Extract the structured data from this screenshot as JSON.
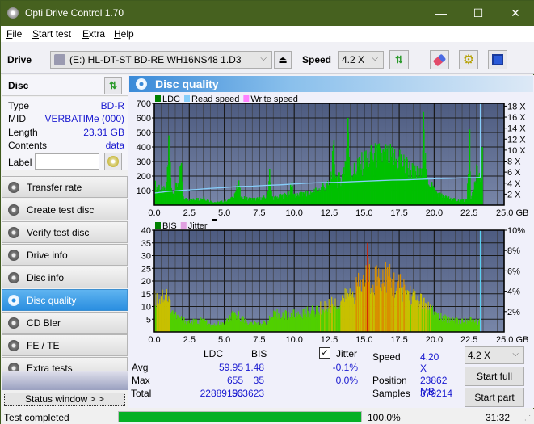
{
  "window": {
    "title": "Opti Drive Control 1.70",
    "minimize": "—",
    "maximize": "☐",
    "close": "✕"
  },
  "menu": [
    {
      "label": "File",
      "u": "F",
      "rest": "ile"
    },
    {
      "label": "Start test",
      "u": "S",
      "rest": "tart test"
    },
    {
      "label": "Extra",
      "u": "E",
      "rest": "xtra"
    },
    {
      "label": "Help",
      "u": "H",
      "rest": "elp"
    }
  ],
  "toolbar": {
    "drive_label": "Drive",
    "drive_value": "(E:)  HL-DT-ST BD-RE  WH16NS48 1.D3",
    "speed_label": "Speed",
    "speed_value": "4.2 X"
  },
  "disc": {
    "header": "Disc",
    "rows": [
      {
        "key": "Type",
        "value": "BD-R"
      },
      {
        "key": "MID",
        "value": "VERBATIMe (000)"
      },
      {
        "key": "Length",
        "value": "23.31 GB"
      },
      {
        "key": "Contents",
        "value": "data"
      }
    ],
    "label_key": "Label",
    "label_value": ""
  },
  "nav": [
    {
      "label": "Transfer rate",
      "active": false
    },
    {
      "label": "Create test disc",
      "active": false
    },
    {
      "label": "Verify test disc",
      "active": false
    },
    {
      "label": "Drive info",
      "active": false
    },
    {
      "label": "Disc info",
      "active": false
    },
    {
      "label": "Disc quality",
      "active": true
    },
    {
      "label": "CD Bler",
      "active": false
    },
    {
      "label": "FE / TE",
      "active": false
    },
    {
      "label": "Extra tests",
      "active": false
    }
  ],
  "status_window_label": "Status window > >",
  "panel_title": "Disc quality",
  "chart_data": [
    {
      "type": "area",
      "title": "LDC / Read speed",
      "legend": [
        {
          "name": "LDC",
          "color": "#008000"
        },
        {
          "name": "Read speed",
          "color": "#87cefa"
        },
        {
          "name": "Write speed",
          "color": "#ff80ff"
        }
      ],
      "legend_position": "top-left",
      "xlabel": "GB",
      "x_ticks": [
        "0.0",
        "2.5",
        "5.0",
        "7.5",
        "10.0",
        "12.5",
        "15.0",
        "17.5",
        "20.0",
        "22.5",
        "25.0 GB"
      ],
      "xlim": [
        0,
        25
      ],
      "y_ticks": [
        "100",
        "200",
        "300",
        "400",
        "500",
        "600",
        "700"
      ],
      "ylim": [
        0,
        700
      ],
      "y2_ticks": [
        "2 X",
        "4 X",
        "6 X",
        "8 X",
        "10 X",
        "12 X",
        "14 X",
        "16 X",
        "18 X"
      ],
      "y2lim": [
        0,
        18.5
      ],
      "grid": true,
      "ldc_profile": [
        [
          0,
          170
        ],
        [
          0.3,
          140
        ],
        [
          0.8,
          120
        ],
        [
          1.0,
          480
        ],
        [
          1.1,
          300
        ],
        [
          1.3,
          80
        ],
        [
          1.9,
          290
        ],
        [
          2.0,
          60
        ],
        [
          2.5,
          45
        ],
        [
          3.0,
          50
        ],
        [
          3.5,
          60
        ],
        [
          4.0,
          30
        ],
        [
          4.5,
          25
        ],
        [
          5.0,
          35
        ],
        [
          5.5,
          55
        ],
        [
          6.0,
          170
        ],
        [
          6.2,
          60
        ],
        [
          6.5,
          60
        ],
        [
          7.0,
          50
        ],
        [
          7.5,
          55
        ],
        [
          8.0,
          70
        ],
        [
          8.2,
          250
        ],
        [
          8.4,
          60
        ],
        [
          9.0,
          75
        ],
        [
          9.5,
          90
        ],
        [
          9.8,
          160
        ],
        [
          10.0,
          80
        ],
        [
          10.5,
          90
        ],
        [
          11.0,
          100
        ],
        [
          11.5,
          120
        ],
        [
          12.0,
          150
        ],
        [
          12.5,
          170
        ],
        [
          12.8,
          450
        ],
        [
          13.0,
          200
        ],
        [
          13.5,
          260
        ],
        [
          13.8,
          600
        ],
        [
          14.0,
          270
        ],
        [
          14.5,
          320
        ],
        [
          15.0,
          370
        ],
        [
          15.5,
          410
        ],
        [
          16.0,
          420
        ],
        [
          16.5,
          420
        ],
        [
          17.0,
          400
        ],
        [
          17.5,
          380
        ],
        [
          18.0,
          330
        ],
        [
          18.5,
          280
        ],
        [
          19.0,
          250
        ],
        [
          19.2,
          640
        ],
        [
          19.4,
          250
        ],
        [
          19.8,
          160
        ],
        [
          20.0,
          120
        ],
        [
          20.5,
          80
        ],
        [
          21.0,
          60
        ],
        [
          21.5,
          45
        ],
        [
          22.0,
          40
        ],
        [
          22.3,
          40
        ],
        [
          22.5,
          520
        ],
        [
          22.6,
          40
        ],
        [
          23.0,
          280
        ],
        [
          23.2,
          220
        ],
        [
          23.3,
          230
        ],
        [
          23.4,
          400
        ]
      ],
      "read_speed": [
        [
          0,
          2.2
        ],
        [
          1,
          2.5
        ],
        [
          2,
          2.7
        ],
        [
          3,
          2.85
        ],
        [
          4,
          3.05
        ],
        [
          5,
          3.2
        ],
        [
          6,
          3.4
        ],
        [
          7,
          3.45
        ],
        [
          8,
          3.6
        ],
        [
          9,
          3.7
        ],
        [
          10,
          3.85
        ],
        [
          11,
          4.0
        ],
        [
          12,
          4.1
        ],
        [
          13,
          4.15
        ],
        [
          14,
          4.25
        ],
        [
          15,
          4.35
        ],
        [
          16,
          4.45
        ],
        [
          17,
          4.55
        ],
        [
          18,
          4.6
        ],
        [
          19,
          4.7
        ],
        [
          20,
          4.8
        ],
        [
          21,
          4.85
        ],
        [
          22,
          4.95
        ],
        [
          23,
          5.0
        ],
        [
          23.3,
          5.05
        ]
      ],
      "read_speed_spike_x": 23.3
    },
    {
      "type": "bar",
      "title": "BIS / Jitter",
      "legend": [
        {
          "name": "BIS",
          "color": "#008000"
        },
        {
          "name": "Jitter",
          "color": "#e0a0e0"
        }
      ],
      "legend_position": "top-left",
      "xlabel": "GB",
      "x_ticks": [
        "0.0",
        "2.5",
        "5.0",
        "7.5",
        "10.0",
        "12.5",
        "15.0",
        "17.5",
        "20.0",
        "22.5",
        "25.0 GB"
      ],
      "xlim": [
        0,
        25
      ],
      "y_ticks": [
        "5",
        "10",
        "15",
        "20",
        "25",
        "30",
        "35",
        "40"
      ],
      "ylim": [
        0,
        40
      ],
      "y2_ticks": [
        "2%",
        "4%",
        "6%",
        "8%",
        "10%"
      ],
      "y2lim": [
        0,
        10
      ],
      "grid": true,
      "bis_profile": [
        [
          0,
          16
        ],
        [
          0.5,
          17
        ],
        [
          0.8,
          20
        ],
        [
          1.0,
          15
        ],
        [
          1.3,
          10
        ],
        [
          1.5,
          8
        ],
        [
          2.0,
          6
        ],
        [
          2.5,
          5
        ],
        [
          3.0,
          5
        ],
        [
          3.5,
          6
        ],
        [
          4.0,
          3
        ],
        [
          4.5,
          4
        ],
        [
          5.0,
          4
        ],
        [
          5.5,
          8
        ],
        [
          6.0,
          8
        ],
        [
          6.5,
          5
        ],
        [
          7.0,
          4
        ],
        [
          7.5,
          4
        ],
        [
          8.0,
          5
        ],
        [
          8.5,
          8
        ],
        [
          9.0,
          9
        ],
        [
          9.5,
          8
        ],
        [
          10.0,
          9
        ],
        [
          10.5,
          9
        ],
        [
          11.0,
          10
        ],
        [
          11.5,
          10
        ],
        [
          12.0,
          12
        ],
        [
          12.5,
          13
        ],
        [
          13.0,
          14
        ],
        [
          13.5,
          16
        ],
        [
          14.0,
          18
        ],
        [
          14.5,
          22
        ],
        [
          15.0,
          24
        ],
        [
          15.2,
          35
        ],
        [
          15.4,
          24
        ],
        [
          15.8,
          27
        ],
        [
          16.2,
          26
        ],
        [
          16.5,
          28
        ],
        [
          17.0,
          24
        ],
        [
          17.5,
          22
        ],
        [
          18.0,
          20
        ],
        [
          18.5,
          17
        ],
        [
          19.0,
          15
        ],
        [
          19.5,
          12
        ],
        [
          20.0,
          9
        ],
        [
          20.5,
          7
        ],
        [
          21.0,
          6
        ],
        [
          21.5,
          6
        ],
        [
          22.0,
          5
        ],
        [
          22.5,
          6
        ],
        [
          23.0,
          5
        ],
        [
          23.3,
          5
        ]
      ],
      "position_marker_x": 23.3
    }
  ],
  "stats": {
    "col_ldc": "LDC",
    "col_bis": "BIS",
    "rows": [
      {
        "label": "Avg",
        "ldc": "59.95",
        "bis": "1.48",
        "jitter": "-0.1%"
      },
      {
        "label": "Max",
        "ldc": "655",
        "bis": "35",
        "jitter": "0.0%"
      },
      {
        "label": "Total",
        "ldc": "22889193",
        "bis": "563623",
        "jitter": ""
      }
    ],
    "jitter_label": "Jitter",
    "jitter_checked": true,
    "speed_label": "Speed",
    "speed_value": "4.20 X",
    "position_label": "Position",
    "position_value": "23862 MB",
    "samples_label": "Samples",
    "samples_value": "379214",
    "speed_select": "4.2 X",
    "start_full": "Start full",
    "start_part": "Start part"
  },
  "statusbar": {
    "text": "Test completed",
    "progress_percent": 100,
    "progress_label": "100.0%",
    "time": "31:32"
  }
}
